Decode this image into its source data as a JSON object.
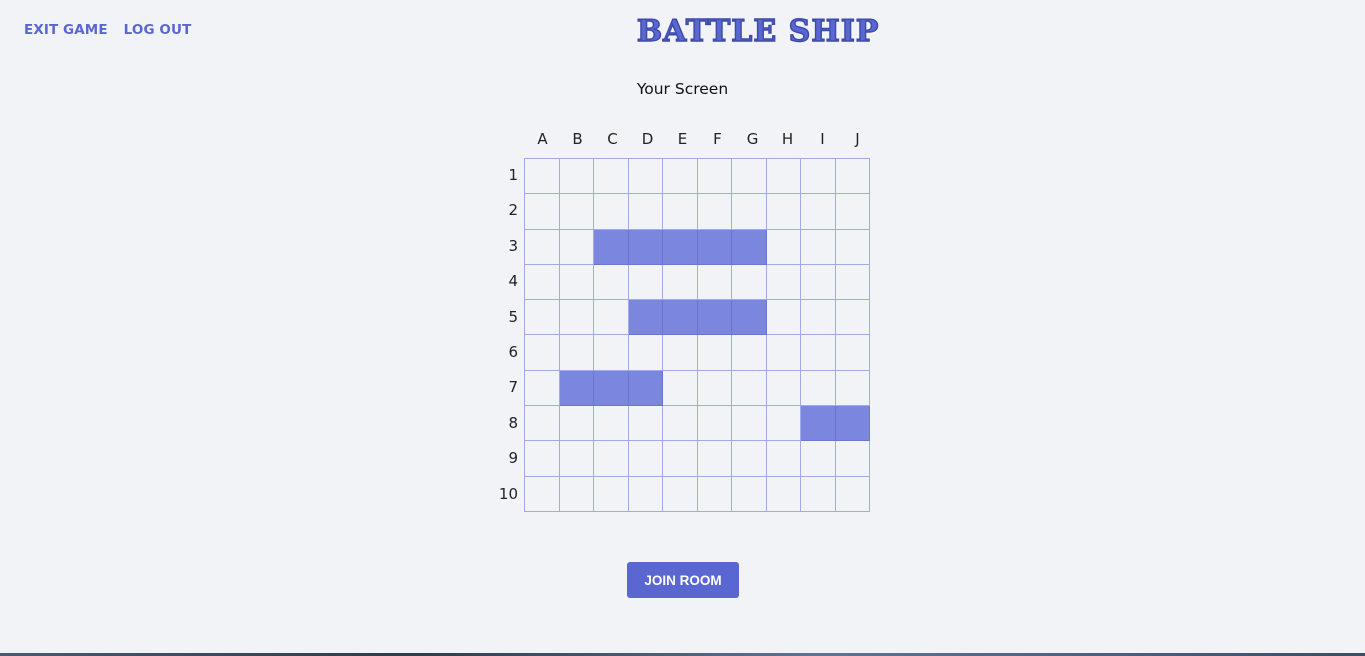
{
  "nav": {
    "exit_label": "EXIT GAME",
    "logout_label": "LOG OUT"
  },
  "logo": {
    "text": "BATTLE SHIP"
  },
  "board": {
    "title": "Your Screen",
    "columns": [
      "A",
      "B",
      "C",
      "D",
      "E",
      "F",
      "G",
      "H",
      "I",
      "J"
    ],
    "rows": [
      "1",
      "2",
      "3",
      "4",
      "5",
      "6",
      "7",
      "8",
      "9",
      "10"
    ],
    "ship_cells": [
      "C3",
      "D3",
      "E3",
      "F3",
      "G3",
      "D5",
      "E5",
      "F5",
      "G5",
      "B7",
      "C7",
      "D7",
      "I8",
      "J8"
    ]
  },
  "actions": {
    "join_label": "JOIN ROOM"
  },
  "colors": {
    "accent": "#5a67d0",
    "ship": "#7b87de",
    "grid_line": "#a3aaec",
    "background": "#f1f3f6"
  }
}
